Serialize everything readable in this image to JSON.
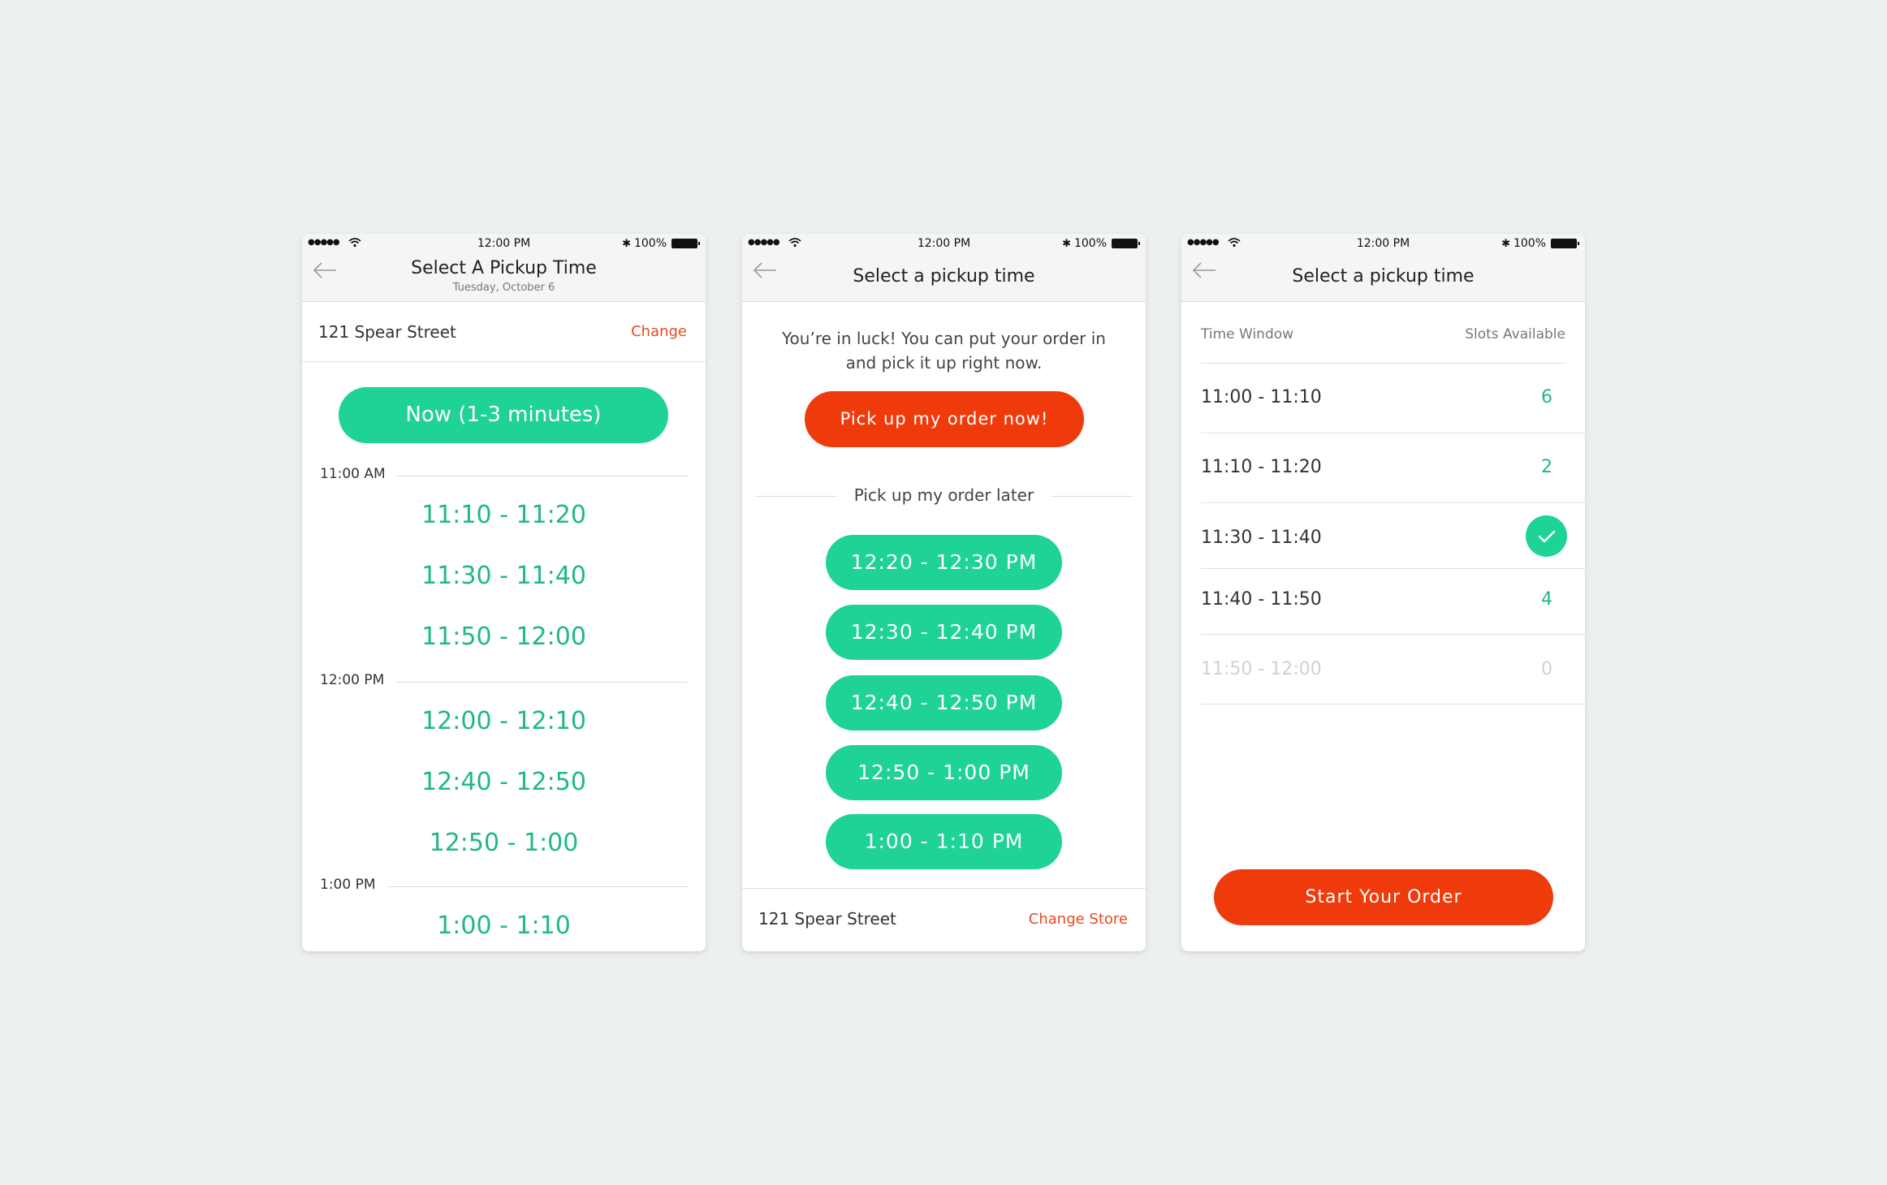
{
  "colors": {
    "background": "#edf0f0",
    "accent_green": "#1fd295",
    "text_green": "#1fb885",
    "accent_red": "#ef3b0c",
    "link_orange": "#e94a1f"
  },
  "status_bar": {
    "signal": "●●●●●",
    "time": "12:00 PM",
    "battery": "100%"
  },
  "screen1": {
    "title": "Select A Pickup Time",
    "subtitle": "Tuesday, October 6",
    "address": "121 Spear Street",
    "change_label": "Change",
    "now_button": "Now (1-3 minutes)",
    "sections": [
      {
        "label": "11:00 AM",
        "slots": [
          "11:10 - 11:20",
          "11:30 - 11:40",
          "11:50 - 12:00"
        ]
      },
      {
        "label": "12:00 PM",
        "slots": [
          "12:00 - 12:10",
          "12:40 - 12:50",
          "12:50 - 1:00"
        ]
      },
      {
        "label": "1:00 PM",
        "slots": [
          "1:00 - 1:10"
        ]
      }
    ]
  },
  "screen2": {
    "title": "Select a pickup time",
    "luck_line1": "You’re in luck! You can put your order in",
    "luck_line2": "and pick it up right now.",
    "now_button": "Pick up my order now!",
    "later_label": "Pick up my order later",
    "time_buttons": [
      "12:20 - 12:30 PM",
      "12:30 - 12:40 PM",
      "12:40 - 12:50 PM",
      "12:50 - 1:00 PM",
      "1:00 - 1:10 PM"
    ],
    "address": "121 Spear Street",
    "change_store_label": "Change Store"
  },
  "screen3": {
    "title": "Select a pickup time",
    "col_time": "Time Window",
    "col_slots": "Slots Available",
    "rows": [
      {
        "time": "11:00 - 11:10",
        "slots": "6",
        "state": "available"
      },
      {
        "time": "11:10 - 11:20",
        "slots": "2",
        "state": "available"
      },
      {
        "time": "11:30 - 11:40",
        "slots": "",
        "state": "selected",
        "icon": "check-icon"
      },
      {
        "time": "11:40 - 11:50",
        "slots": "4",
        "state": "available"
      },
      {
        "time": "11:50 - 12:00",
        "slots": "0",
        "state": "disabled"
      }
    ],
    "start_button": "Start Your Order"
  }
}
